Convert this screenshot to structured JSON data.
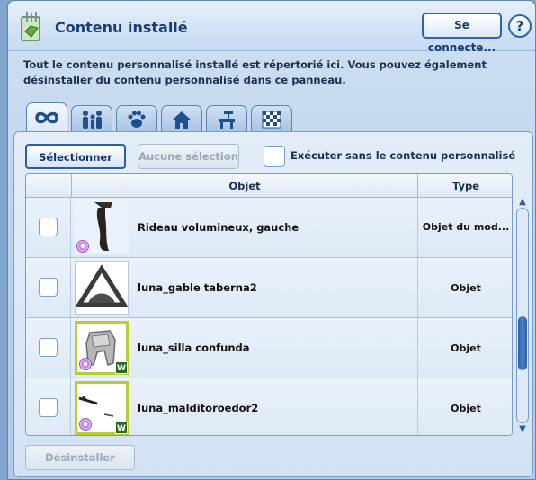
{
  "window": {
    "title": "Contenu installé",
    "connect_label": "Se connecte...",
    "help_label": "?"
  },
  "description": "Tout le contenu personnalisé installé est répertorié ici. Vous pouvez également désinstaller du contenu personnalisé dans ce panneau.",
  "tabs": [
    {
      "icon": "infinity-icon",
      "active": true
    },
    {
      "icon": "family-icon",
      "active": false
    },
    {
      "icon": "paw-icon",
      "active": false
    },
    {
      "icon": "house-icon",
      "active": false
    },
    {
      "icon": "chair-icon",
      "active": false
    },
    {
      "icon": "pattern-icon",
      "active": false
    }
  ],
  "toolbar": {
    "select_all_label": "Sélectionner tout",
    "select_none_label": "Aucune sélection",
    "exec_label": "Exécuter sans le contenu personnalisé",
    "exec_checked": false
  },
  "table": {
    "columns": [
      "",
      "Objet",
      "Type"
    ],
    "rows": [
      {
        "name": "Rideau volumineux, gauche",
        "type": "Objet du mod...",
        "checked": false,
        "badge_w": false
      },
      {
        "name": "luna_gable taberna2",
        "type": "Objet",
        "checked": false,
        "badge_w": false
      },
      {
        "name": "luna_silla confunda",
        "type": "Objet",
        "checked": false,
        "badge_w": true
      },
      {
        "name": "luna_malditoroedor2",
        "type": "Objet",
        "checked": false,
        "badge_w": true
      }
    ]
  },
  "footer": {
    "uninstall_label": "Désinstaller"
  },
  "colors": {
    "accent": "#2a5da0",
    "panel": "#d3e2f3",
    "thumb_border_green": "#b9cd33"
  }
}
